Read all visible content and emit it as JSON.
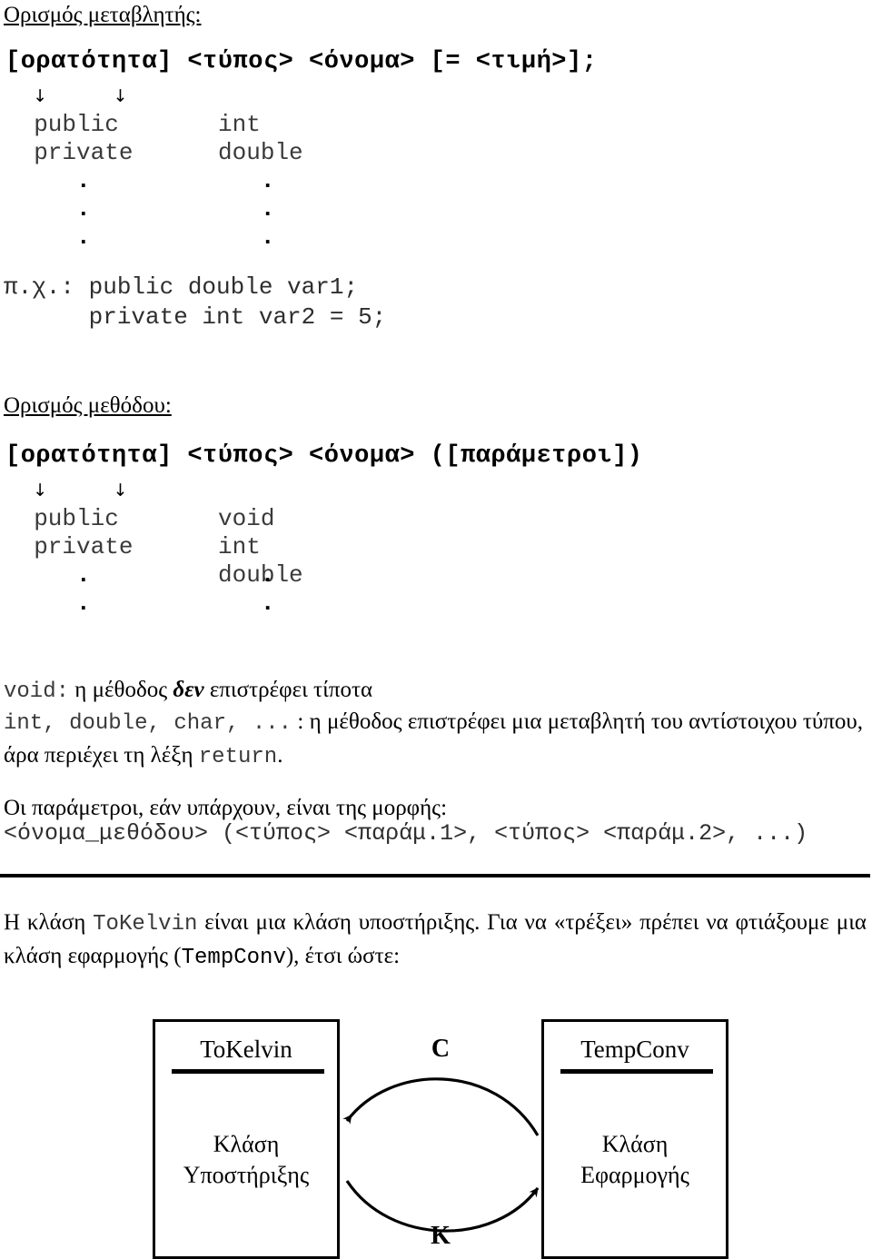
{
  "document": {
    "variable_section": {
      "heading": "Ορισμός μεταβλητής:",
      "syntax": "[ορατότητα] <τύπος> <όνομα> [= <τιμή>];",
      "arrows": "     ↓            ↓",
      "keywords": "  public       int\n  private      double",
      "dots": "     .            .\n     .            .\n     .            .",
      "example": "π.χ.: public double var1;\n      private int var2 = 5;"
    },
    "method_section": {
      "heading": "Ορισμός μεθόδου:",
      "syntax": "[ορατότητα] <τύπος> <όνομα> ([παράμετροι])",
      "arrows": "     ↓            ↓",
      "keywords": "  public       void\n  private      int\n     .         double",
      "dots": "     .            .\n     .            .",
      "void_line_pre": "void:",
      "void_line_mid": " η μέθοδος ",
      "void_line_bold": "δεν",
      "void_line_post": " επιστρέφει τίποτα",
      "types_line_mono": "int, double, char, ...",
      "types_line_text": " : η μέθοδος επιστρέφει μια μεταβλητή του αντίστοιχου τύπου, άρα περιέχει τη λέξη ",
      "types_line_return": "return",
      "types_line_end": ".",
      "params_intro": "Οι παράμετροι, εάν υπάρχουν, είναι της μορφής:",
      "params_form": "<όνομα_μεθόδου> (<τύπος> <παράμ.1>, <τύπος> <παράμ.2>, ...)"
    },
    "tokelvin_section": {
      "text_1": "Η κλάση ",
      "class_1": "ToKelvin",
      "text_2": "  είναι μια κλάση υποστήριξης. Για να «τρέξει» πρέπει να φτιάξουμε μια κλάση εφαρμογής (",
      "class_2": "TempConv",
      "text_3": "), έτσι ώστε:"
    },
    "diagram": {
      "left_box": {
        "title": "ToKelvin",
        "role_line_1": "Κλάση",
        "role_line_2": "Υποστήριξης"
      },
      "right_box": {
        "title": "TempConv",
        "role_line_1": "Κλάση",
        "role_line_2": "Εφαρμογής"
      },
      "top_arrow_label": "C",
      "bottom_arrow_label": "K"
    }
  }
}
